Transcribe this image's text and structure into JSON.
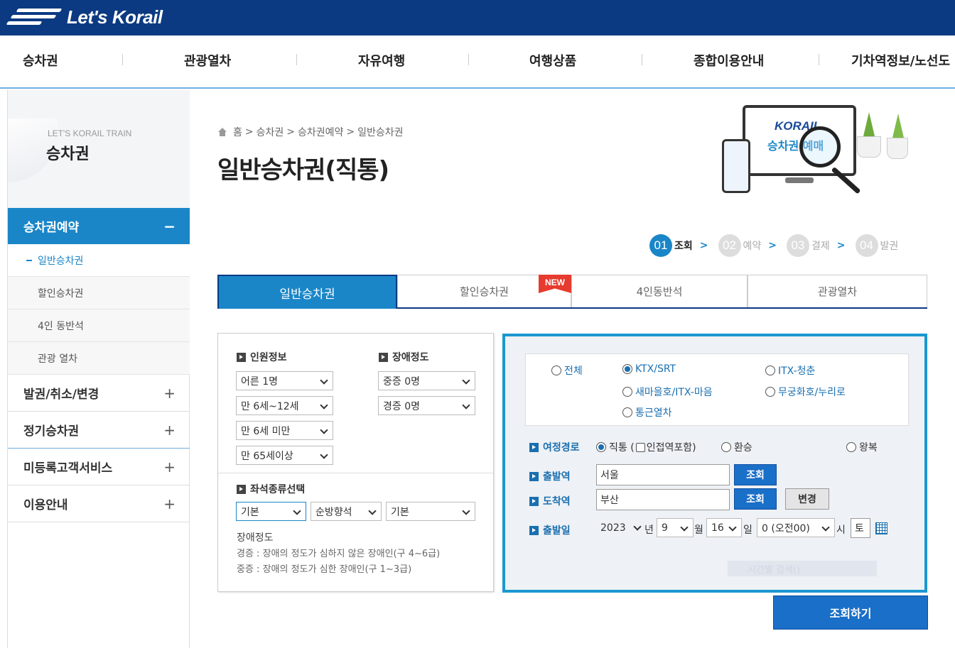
{
  "header": {
    "logo_text": "Let's Korail",
    "nav": [
      "승차권",
      "관광열차",
      "자유여행",
      "여행상품",
      "종합이용안내",
      "기차역정보/노선도"
    ]
  },
  "sidebar": {
    "small_title": "LET'S KORAIL TRAIN",
    "title": "승차권",
    "active_menu": {
      "label": "승차권예약",
      "sign": "−"
    },
    "sub_items": [
      {
        "label": "일반승차권"
      },
      {
        "label": "할인승차권"
      },
      {
        "label": "4인 동반석"
      },
      {
        "label": "관광 열차"
      }
    ],
    "menus": [
      {
        "label": "발권/취소/변경",
        "sign": "+"
      },
      {
        "label": "정기승차권",
        "sign": "+"
      },
      {
        "label": "미등록고객서비스",
        "sign": "+"
      },
      {
        "label": "이용안내",
        "sign": "+"
      }
    ]
  },
  "breadcrumb": {
    "home": "홈",
    "sep": ">",
    "items": [
      "승차권",
      "승차권예약",
      "일반승차권"
    ]
  },
  "page_title": "일반승차권(직통)",
  "hero": {
    "brand": "KORAIL",
    "label": "승차권 예매"
  },
  "steps": [
    {
      "num": "01",
      "label": "조회",
      "chev": ">"
    },
    {
      "num": "02",
      "label": "예약",
      "chev": ">"
    },
    {
      "num": "03",
      "label": "결제",
      "chev": ">"
    },
    {
      "num": "04",
      "label": "발권"
    }
  ],
  "tabs": [
    "일반승차권",
    "할인승차권",
    "4인동반석",
    "관광열차"
  ],
  "new_badge": "NEW",
  "passenger": {
    "label": "인원정보",
    "selects": [
      "어른 1명",
      "만 6세~12세",
      "만 6세 미만",
      "만 65세이상"
    ],
    "disability_label": "장애정도",
    "disability_selects": [
      "중증 0명",
      "경증 0명"
    ],
    "seat_label": "좌석종류선택",
    "seat_selects": [
      "기본",
      "순방향석",
      "기본"
    ],
    "note_title": "장애정도",
    "notes": [
      "경증 : 장애의 정도가 심하지 않은 장애인(구 4~6급)",
      "중증 : 장애의 정도가 심한 장애인(구 1~3급)"
    ]
  },
  "route": {
    "train_types": [
      {
        "label": "전체",
        "checked": false
      },
      {
        "label": "KTX/SRT",
        "checked": true
      },
      {
        "label": "ITX-청춘",
        "checked": false
      },
      {
        "label": "새마을호/ITX-마음",
        "checked": false
      },
      {
        "label": "무궁화호/누리로",
        "checked": false
      },
      {
        "label": "통근열차",
        "checked": false
      }
    ],
    "route_label": "여정경로",
    "route_opts": {
      "direct": "직통 (",
      "nearby": "인접역포함)",
      "transfer": "환승",
      "round": "왕복"
    },
    "dep_label": "출발역",
    "dep_value": "서울",
    "arr_label": "도착역",
    "arr_value": "부산",
    "lookup_btn": "조회",
    "swap_btn": "변경",
    "date_label": "출발일",
    "year": "2023",
    "year_unit": "년",
    "month": "9",
    "month_unit": "월",
    "day": "16",
    "day_unit": "일",
    "hour": "0 (오전00)",
    "hour_unit": "시",
    "weekday": "토",
    "faded_text": "시간별 검색()"
  },
  "search_button": "조회하기"
}
